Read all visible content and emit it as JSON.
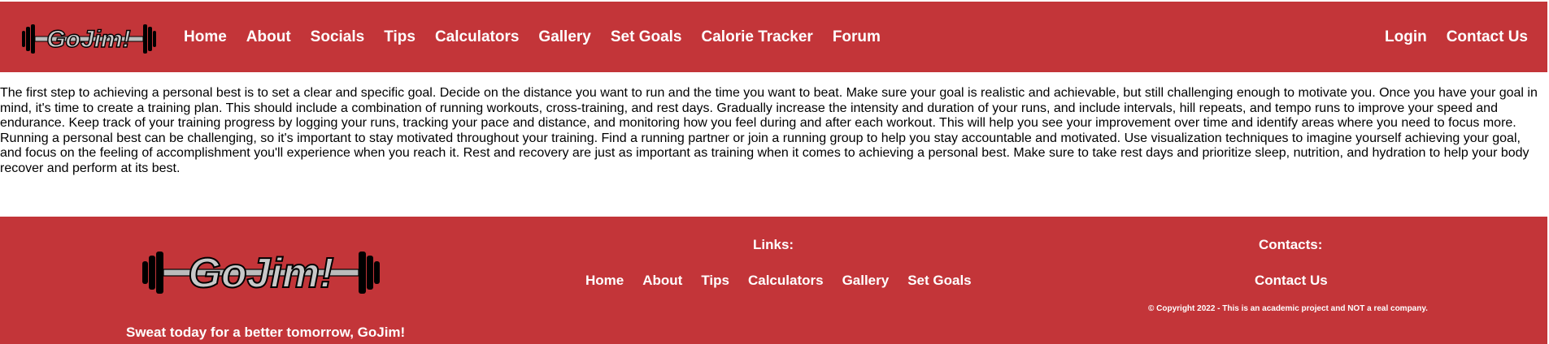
{
  "header": {
    "logo_text": "GoJim!",
    "nav": [
      "Home",
      "About",
      "Socials",
      "Tips",
      "Calculators",
      "Gallery",
      "Set Goals",
      "Calorie Tracker",
      "Forum"
    ],
    "right_nav": [
      "Login",
      "Contact Us"
    ]
  },
  "main": {
    "paragraph": "The first step to achieving a personal best is to set a clear and specific goal. Decide on the distance you want to run and the time you want to beat. Make sure your goal is realistic and achievable, but still challenging enough to motivate you. Once you have your goal in mind, it's time to create a training plan. This should include a combination of running workouts, cross-training, and rest days. Gradually increase the intensity and duration of your runs, and include intervals, hill repeats, and tempo runs to improve your speed and endurance. Keep track of your training progress by logging your runs, tracking your pace and distance, and monitoring how you feel during and after each workout. This will help you see your improvement over time and identify areas where you need to focus more. Running a personal best can be challenging, so it's important to stay motivated throughout your training. Find a running partner or join a running group to help you stay accountable and motivated. Use visualization techniques to imagine yourself achieving your goal, and focus on the feeling of accomplishment you'll experience when you reach it. Rest and recovery are just as important as training when it comes to achieving a personal best. Make sure to take rest days and prioritize sleep, nutrition, and hydration to help your body recover and perform at its best."
  },
  "footer": {
    "logo_text": "GoJim!",
    "tagline": "Sweat today for a better tomorrow, GoJim!",
    "links_title": "Links:",
    "links": [
      "Home",
      "About",
      "Tips",
      "Calculators",
      "Gallery",
      "Set Goals"
    ],
    "contacts_title": "Contacts:",
    "contact_link": "Contact Us",
    "copyright": "© Copyright 2022 - This is an academic project and NOT a real company."
  },
  "colors": {
    "brand_red": "#c33539",
    "text_white": "#ffffff",
    "logo_gray": "#c8c8c8"
  },
  "icons": {
    "logo": "barbell-logo-icon"
  }
}
